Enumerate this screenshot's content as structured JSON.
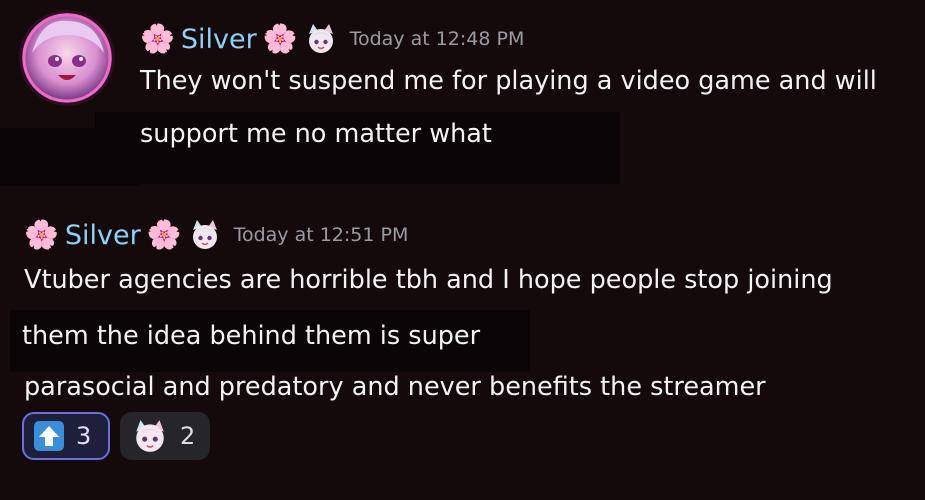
{
  "messages": [
    {
      "username": "Silver",
      "flower_left": "🌸",
      "flower_right": "🌸",
      "timestamp": "Today at 12:48 PM",
      "lines": [
        "They won't suspend me for playing a video game and will",
        "support me no matter what"
      ]
    },
    {
      "username": "Silver",
      "flower_left": "🌸",
      "flower_right": "🌸",
      "timestamp": "Today at 12:51 PM",
      "lines": [
        "Vtuber agencies are horrible tbh and I hope people stop joining",
        "them the idea behind them is super",
        "parasocial and predatory and never benefits the streamer"
      ]
    }
  ],
  "reactions": [
    {
      "icon": "up-arrow-icon",
      "count": "3",
      "active": true
    },
    {
      "icon": "anime-emote-icon",
      "count": "2",
      "active": false
    }
  ],
  "colors": {
    "username": "#8ed0f7",
    "timestamp": "#9a9ca3",
    "background": "#140a0c",
    "active_reaction_border": "#6b6fe0"
  }
}
